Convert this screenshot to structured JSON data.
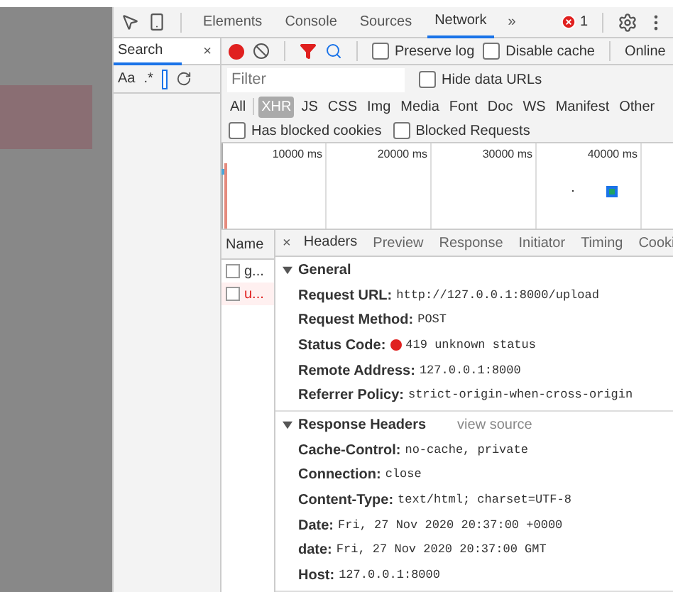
{
  "panel_tabs": [
    {
      "label": "Elements",
      "selected": false
    },
    {
      "label": "Console",
      "selected": false
    },
    {
      "label": "Sources",
      "selected": false
    },
    {
      "label": "Network",
      "selected": true
    }
  ],
  "more_tabs": "»",
  "error_count": "1",
  "search_panel": {
    "tab": "Search",
    "selected": true,
    "close": "×",
    "options": [
      "Aa",
      ".*"
    ]
  },
  "network_toolbar": {
    "recording": true,
    "checkboxes": [
      {
        "label": "Preserve log",
        "checked": false
      },
      {
        "label": "Disable cache",
        "checked": false
      }
    ],
    "throttling": "Online"
  },
  "filter": {
    "placeholder": "Filter",
    "hide_data_urls": {
      "label": "Hide data URLs",
      "checked": false
    }
  },
  "type_filters": [
    {
      "label": "All",
      "selected": false
    },
    {
      "label": "XHR",
      "selected": true
    },
    {
      "label": "JS",
      "selected": false
    },
    {
      "label": "CSS",
      "selected": false
    },
    {
      "label": "Img",
      "selected": false
    },
    {
      "label": "Media",
      "selected": false
    },
    {
      "label": "Font",
      "selected": false
    },
    {
      "label": "Doc",
      "selected": false
    },
    {
      "label": "WS",
      "selected": false
    },
    {
      "label": "Manifest",
      "selected": false
    },
    {
      "label": "Other",
      "selected": false
    }
  ],
  "blocked_filters": [
    {
      "label": "Has blocked cookies",
      "checked": false
    },
    {
      "label": "Blocked Requests",
      "checked": false
    }
  ],
  "timeline": {
    "ticks": [
      "10000 ms",
      "20000 ms",
      "30000 ms",
      "40000 ms"
    ]
  },
  "requests": {
    "header": "Name",
    "rows": [
      {
        "name": "g...",
        "failed": false,
        "checked": false
      },
      {
        "name": "u...",
        "failed": true,
        "checked": false
      }
    ]
  },
  "details": {
    "close": "×",
    "tabs": [
      {
        "label": "Headers",
        "selected": true
      },
      {
        "label": "Preview",
        "selected": false
      },
      {
        "label": "Response",
        "selected": false
      },
      {
        "label": "Initiator",
        "selected": false
      },
      {
        "label": "Timing",
        "selected": false
      },
      {
        "label": "Cooki",
        "selected": false
      }
    ],
    "sections": [
      {
        "title": "General",
        "expanded": true,
        "fields": [
          {
            "key": "Request URL:",
            "value": "http://127.0.0.1:8000/upload",
            "kind": "plain"
          },
          {
            "key": "Request Method:",
            "value": "POST",
            "kind": "plain"
          },
          {
            "key": "Status Code:",
            "value": "419 unknown status",
            "kind": "status"
          },
          {
            "key": "Remote Address:",
            "value": "127.0.0.1:8000",
            "kind": "plain"
          },
          {
            "key": "Referrer Policy:",
            "value": "strict-origin-when-cross-origin",
            "kind": "plain"
          }
        ]
      },
      {
        "title": "Response Headers",
        "link": "view source",
        "expanded": true,
        "fields": [
          {
            "key": "Cache-Control:",
            "value": "no-cache, private",
            "kind": "plain"
          },
          {
            "key": "Connection:",
            "value": "close",
            "kind": "plain"
          },
          {
            "key": "Content-Type:",
            "value": "text/html; charset=UTF-8",
            "kind": "plain"
          },
          {
            "key": "Date:",
            "value": "Fri, 27 Nov 2020 20:37:00 +0000",
            "kind": "plain"
          },
          {
            "key": "date:",
            "value": "Fri, 27 Nov 2020 20:37:00 GMT",
            "kind": "plain"
          },
          {
            "key": "Host:",
            "value": "127.0.0.1:8000",
            "kind": "plain"
          }
        ]
      }
    ]
  }
}
